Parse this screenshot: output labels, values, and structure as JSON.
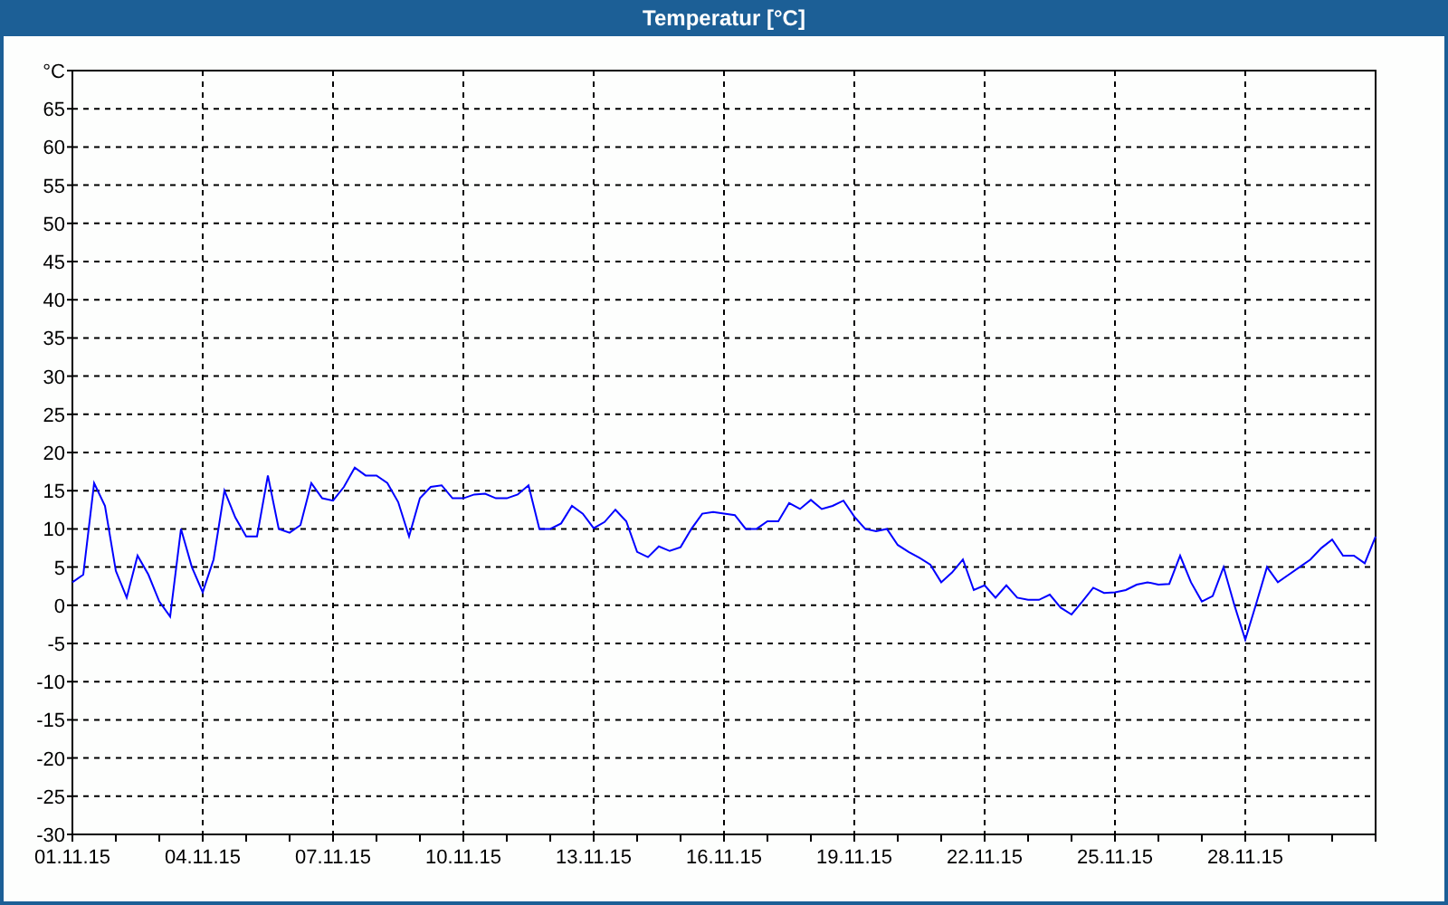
{
  "window": {
    "title": "Temperatur [°C]"
  },
  "chart": {
    "chart_data": {
      "type": "line",
      "categories": [
        "01.11.15",
        null,
        null,
        null,
        null,
        null,
        null,
        null,
        null,
        null,
        null,
        null,
        "04.11.15",
        null,
        null,
        null,
        null,
        null,
        null,
        null,
        null,
        null,
        null,
        null,
        "07.11.15",
        null,
        null,
        null,
        null,
        null,
        null,
        null,
        null,
        null,
        null,
        null,
        "10.11.15",
        null,
        null,
        null,
        null,
        null,
        null,
        null,
        null,
        null,
        null,
        null,
        "13.11.15",
        null,
        null,
        null,
        null,
        null,
        null,
        null,
        null,
        null,
        null,
        null,
        "16.11.15",
        null,
        null,
        null,
        null,
        null,
        null,
        null,
        null,
        null,
        null,
        null,
        "19.11.15",
        null,
        null,
        null,
        null,
        null,
        null,
        null,
        null,
        null,
        null,
        null,
        "22.11.15",
        null,
        null,
        null,
        null,
        null,
        null,
        null,
        null,
        null,
        null,
        null,
        "25.11.15",
        null,
        null,
        null,
        null,
        null,
        null,
        null,
        null,
        null,
        null,
        null,
        "28.11.15",
        null,
        null,
        null,
        null,
        null,
        null,
        null,
        null,
        null,
        null,
        null,
        null
      ],
      "series": [
        {
          "color": "#0000ff",
          "values": [
            3,
            4,
            16,
            13,
            4.5,
            1,
            6.5,
            4,
            0.5,
            -1.5,
            10,
            5,
            1.7,
            6,
            15,
            11.5,
            9,
            9,
            17,
            10,
            9.5,
            10.5,
            16,
            14,
            13.7,
            15.5,
            18,
            17,
            17,
            16,
            13.5,
            9,
            14,
            15.5,
            15.7,
            14,
            14,
            14.5,
            14.6,
            14,
            14,
            14.5,
            15.7,
            10,
            10,
            10.7,
            13,
            12,
            10.1,
            10.9,
            12.5,
            11,
            7,
            6.3,
            7.7,
            7.1,
            7.6,
            10,
            12,
            12.2,
            12,
            11.8,
            10,
            10,
            11,
            11,
            13.4,
            12.6,
            13.8,
            12.6,
            13,
            13.7,
            11.6,
            10,
            9.7,
            10,
            7.9,
            7,
            6.2,
            5.3,
            3,
            4.3,
            6,
            2,
            2.6,
            1,
            2.6,
            1,
            0.7,
            0.7,
            1.4,
            -0.3,
            -1.2,
            0.5,
            2.3,
            1.6,
            1.7,
            2,
            2.7,
            3,
            2.7,
            2.8,
            6.5,
            3,
            0.5,
            1.2,
            5,
            0,
            -4.5,
            0.2,
            5,
            3,
            4,
            5,
            6,
            7.5,
            8.6,
            6.5,
            6.5,
            5.5,
            9
          ]
        }
      ],
      "grid": true,
      "ylim": [
        -30,
        70
      ],
      "yticks": [
        -30,
        -25,
        -20,
        -15,
        -10,
        -5,
        0,
        5,
        10,
        15,
        20,
        25,
        30,
        35,
        40,
        45,
        50,
        55,
        60,
        65,
        {
          "value": 70,
          "label": "°C"
        }
      ]
    }
  }
}
